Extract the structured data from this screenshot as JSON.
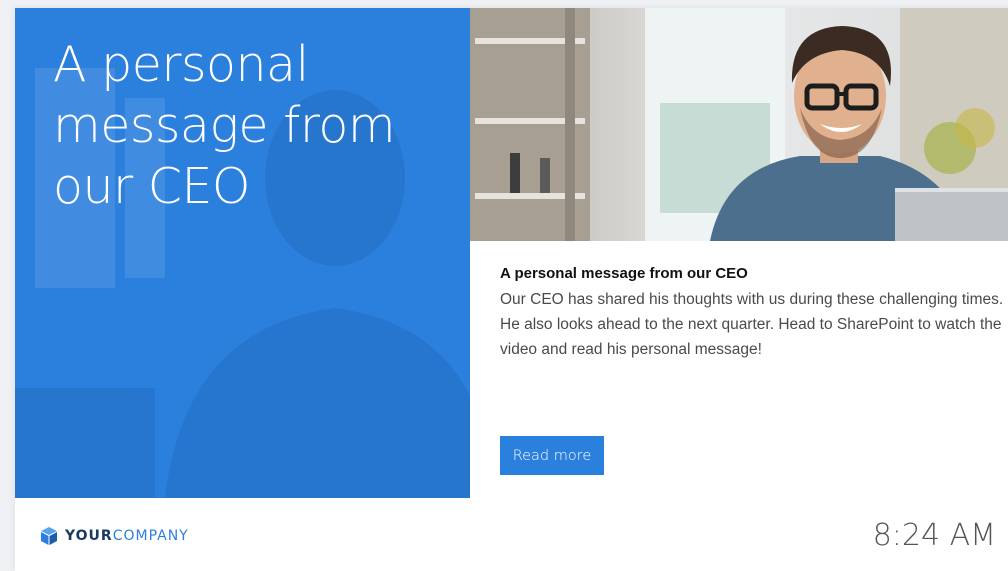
{
  "hero": {
    "title": "A personal message from our CEO"
  },
  "article": {
    "title": "A personal message from our CEO",
    "body": "Our CEO has shared his thoughts with us during these challenging times. He also looks ahead to the next quarter. Head to SharePoint to watch the video and read his personal message!",
    "cta_label": "Read more"
  },
  "footer": {
    "brand_strong": "YOUR",
    "brand_light": "COMPANY",
    "time": "8:24 AM"
  },
  "colors": {
    "accent": "#2b7fdd",
    "brand_dark": "#1a3a63"
  },
  "icons": {
    "brand": "company-cube-icon"
  }
}
